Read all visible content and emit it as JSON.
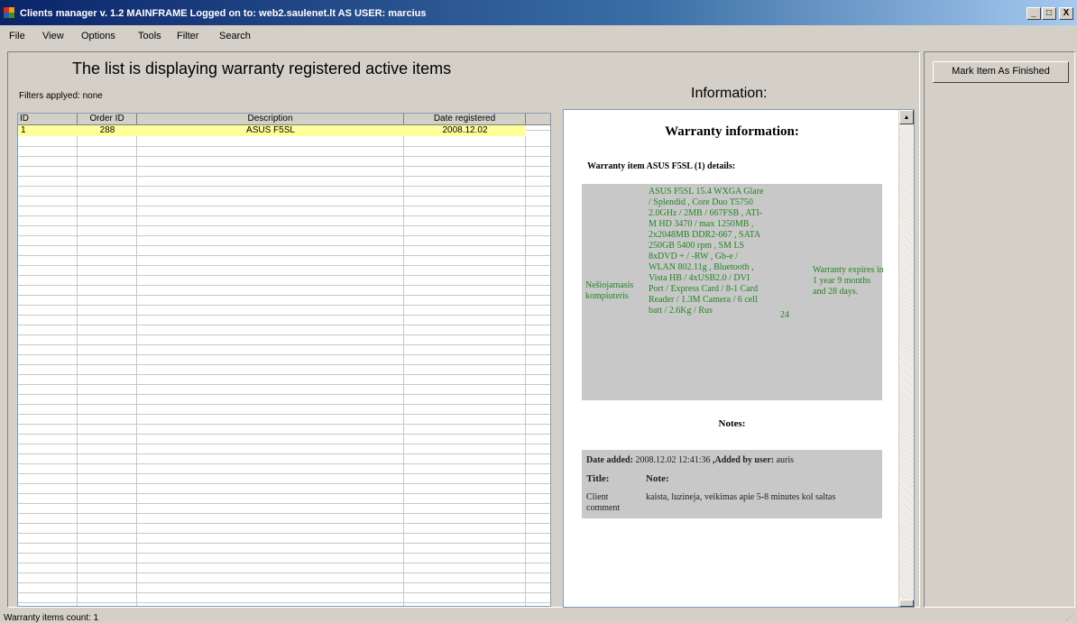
{
  "window": {
    "title": "Clients manager  v. 1.2 MAINFRAME Logged on to: web2.saulenet.lt AS USER: marcius",
    "minimize": "_",
    "maximize": "□",
    "close": "X"
  },
  "menu": [
    "File",
    "View",
    "Options",
    "Tools",
    "Filter",
    "Search"
  ],
  "list": {
    "title": "The list is displaying warranty registered active items",
    "filters": "Filters applyed: none",
    "columns": [
      "ID",
      "Order ID",
      "Description",
      "Date registered"
    ],
    "rows": [
      {
        "id": "1",
        "order_id": "288",
        "description": "ASUS F5SL",
        "date": "2008.12.02",
        "selected": true
      }
    ]
  },
  "info": {
    "heading": "Information:",
    "warranty_title": "Warranty information:",
    "details_heading": "Warranty item ASUS F5SL (1) details:",
    "item": {
      "category": "Nešiojamasis kompiuteris",
      "specs": "ASUS F5SL 15.4 WXGA Glare / Splendid , Core Duo T5750 2.0GHz / 2MB / 667FSB , ATI-M HD 3470 / max 1250MB , 2x2048MB DDR2-667 , SATA 250GB 5400 rpm , SM LS 8xDVD + / -RW , Gb-e / WLAN 802.11g , Bluetooth , Vista HB / 4xUSB2.0 / DVI Port / Express Card / 8-1 Card Reader / 1.3M Camera / 6 cell batt / 2.6Kg / Rus",
      "months": "24",
      "expiry": "Warranty expires in 1 year 9 months and 28 days."
    },
    "notes_heading": "Notes:",
    "note": {
      "date_label": "Date added:",
      "date": "2008.12.02 12:41:36",
      "added_by_label": ",Added by user:",
      "user": "auris",
      "title_header": "Title:",
      "note_header": "Note:",
      "title": "Client comment",
      "text": "kaista, luzineja, veikimas apie 5-8 minutes kol saltas"
    }
  },
  "actions": {
    "mark_finished": "Mark Item As Finished"
  },
  "status": {
    "text": "Warranty items count: 1"
  },
  "colors": {
    "selected_row": "#ffff99",
    "spec_text": "#248424",
    "box_bg": "#c8c8c8"
  }
}
